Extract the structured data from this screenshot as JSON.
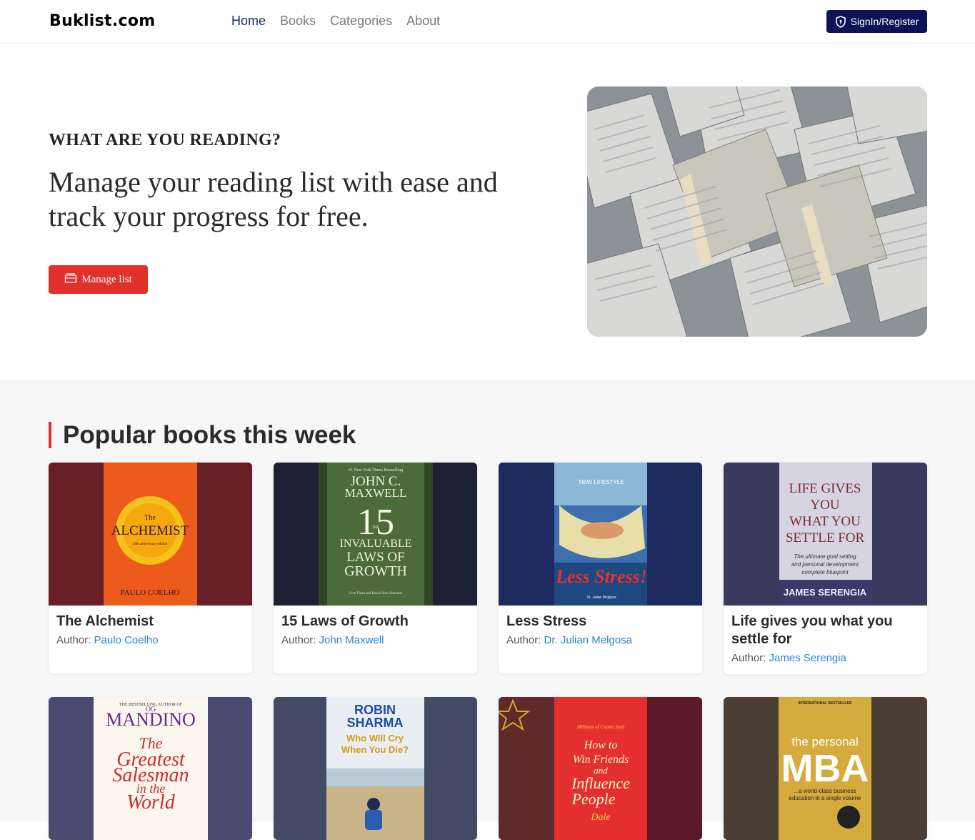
{
  "nav": {
    "brand": "Buklist.com",
    "links": [
      "Home",
      "Books",
      "Categories",
      "About"
    ],
    "signin_label": "SignIn/Register"
  },
  "hero": {
    "eyebrow": "WHAT ARE YOU READING?",
    "headline": "Manage your reading list with ease and track your progress for free.",
    "cta_label": "Manage list"
  },
  "popular": {
    "title": "Popular books this week",
    "author_prefix": "Author:",
    "books": [
      {
        "title": "The Alchemist",
        "author": "Paulo Coelho",
        "cover": {
          "top": "The",
          "main": "ALCHEMIST",
          "sub": "25th anniversary edition",
          "author": "PAULO COELHO"
        }
      },
      {
        "title": "15 Laws of Growth",
        "author": "John Maxwell",
        "cover": {
          "top": "#1 New York Times Bestselling",
          "name1": "JOHN C.",
          "name2": "MAXWELL",
          "num": "15",
          "the": "THE",
          "l1": "INVALUABLE",
          "l2": "LAWS OF",
          "l3": "GROWTH",
          "tag": "Live Them and Reach Your Potential"
        }
      },
      {
        "title": "Less Stress",
        "author": "Dr. Julian Melgosa",
        "cover": {
          "series": "NEW LIFESTYLE",
          "main": "Less Stress!",
          "author": "Dr. Julian Melgosa"
        }
      },
      {
        "title": "Life gives you what you settle for",
        "author": "James Serengia",
        "cover": {
          "l1": "LIFE GIVES",
          "l2": "YOU",
          "l3": "WHAT YOU",
          "l4": "SETTLE FOR",
          "s1": "The ultimate goal setting",
          "s2": "and personal development",
          "s3": "complete blueprint",
          "author": "JAMES SERENGIA"
        }
      },
      {
        "title": "",
        "author": "",
        "cover": {
          "top": "THE BESTSELLING AUTHOR OF",
          "name1": "OG",
          "name2": "MANDINO",
          "l1": "The",
          "l2": "Greatest",
          "l3": "Salesman",
          "l4": "in the",
          "l5": "World"
        }
      },
      {
        "title": "",
        "author": "",
        "cover": {
          "name1": "ROBIN",
          "name2": "SHARMA",
          "l1": "Who Will Cry",
          "l2": "When You Die?"
        }
      },
      {
        "title": "",
        "author": "",
        "cover": {
          "top": "Millions of Copies Sold",
          "l1": "How to",
          "l2": "Win Friends",
          "l3": "and",
          "l4": "Influence",
          "l5": "People",
          "author": "Dale"
        }
      },
      {
        "title": "",
        "author": "",
        "cover": {
          "top": "INTERNATIONAL BESTSELLER",
          "l1": "the personal",
          "l2": "MBA",
          "s1": "...a world-class business",
          "s2": "education in a single volume"
        }
      }
    ]
  },
  "colors": {
    "accent_red": "#e3302b",
    "navy": "#0b1354",
    "link_blue": "#2f84d1"
  },
  "icons": {
    "signin": "shield-icon",
    "manage": "list-icon"
  }
}
